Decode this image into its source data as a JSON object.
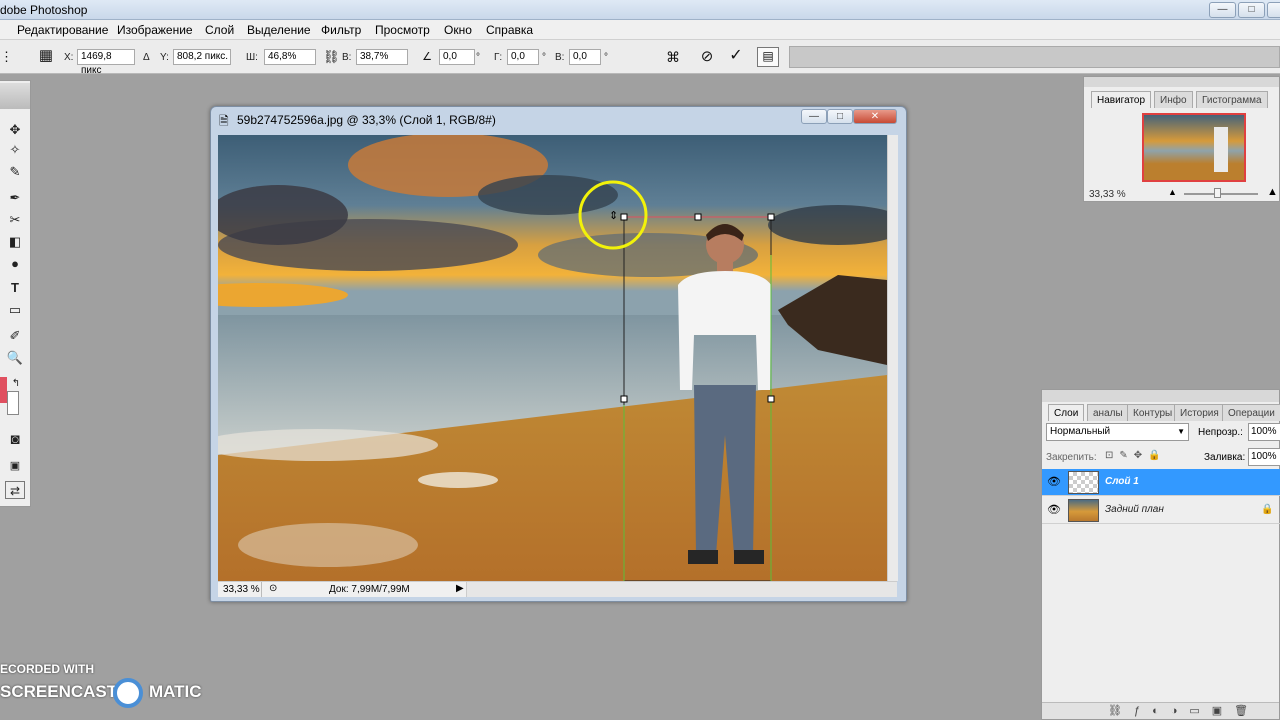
{
  "app": {
    "title": "dobe Photoshop"
  },
  "window_controls": {
    "minimize": "—",
    "maximize": "□",
    "close": "✕"
  },
  "menu": [
    "Редактирование",
    "Изображение",
    "Слой",
    "Выделение",
    "Фильтр",
    "Просмотр",
    "Окно",
    "Справка"
  ],
  "options": {
    "x_label": "X:",
    "x_value": "1469,8 пикс",
    "delta_label": "Δ",
    "y_label": "Y:",
    "y_value": "808,2 пикс.",
    "w_label": "Ш:",
    "w_value": "46,8%",
    "h_label": "В:",
    "h_value": "38,7%",
    "angle_value": "0,0",
    "angle_unit": "°",
    "hskew_label": "Г:",
    "hskew_value": "0,0",
    "hskew_unit": "°",
    "vskew_label": "В:",
    "vskew_value": "0,0",
    "vskew_unit": "°"
  },
  "document": {
    "title": "59b274752596a.jpg @ 33,3% (Слой 1, RGB/8#)",
    "zoom": "33,33 %",
    "doc_info": "Док: 7,99M/7,99M"
  },
  "navigator": {
    "tabs": [
      "Навигатор",
      "Инфо",
      "Гистограмма"
    ],
    "zoom": "33,33 %"
  },
  "layers": {
    "tabs": [
      "Слои",
      "аналы",
      "Контуры",
      "История",
      "Операции"
    ],
    "blend_mode": "Нормальный",
    "opacity_label": "Непрозр.:",
    "opacity_value": "100%",
    "lock_label": "Закрепить:",
    "fill_label": "Заливка:",
    "fill_value": "100%",
    "items": [
      {
        "name": "Слой 1",
        "selected": true
      },
      {
        "name": "Задний план",
        "selected": false
      }
    ]
  },
  "watermark": {
    "line1": "ECORDED WITH",
    "line2": "SCREENCAST",
    "line3": "MATIC"
  },
  "colors": {
    "selection": "#3399ff",
    "foreground": "#e05060",
    "highlight_circle": "#f2f20a"
  }
}
